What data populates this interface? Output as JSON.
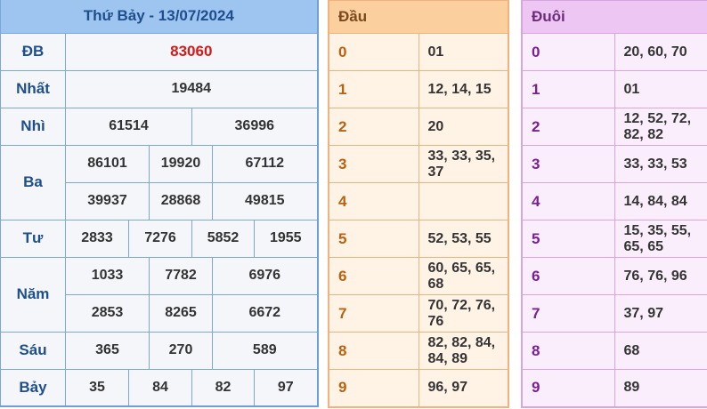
{
  "results": {
    "title": "Thứ Bảy - 13/07/2024",
    "db_label": "ĐB",
    "db_value": "83060",
    "nhat_label": "Nhất",
    "nhat_value": "19484",
    "nhi_label": "Nhì",
    "nhi_values": [
      "61514",
      "36996"
    ],
    "ba_label": "Ba",
    "ba_values": [
      "86101",
      "19920",
      "67112",
      "39937",
      "28868",
      "49815"
    ],
    "tu_label": "Tư",
    "tu_values": [
      "2833",
      "7276",
      "5852",
      "1955"
    ],
    "nam_label": "Năm",
    "nam_values": [
      "1033",
      "7782",
      "6976",
      "2853",
      "8265",
      "6672"
    ],
    "sau_label": "Sáu",
    "sau_values": [
      "365",
      "270",
      "589"
    ],
    "bay_label": "Bảy",
    "bay_values": [
      "35",
      "84",
      "82",
      "97"
    ]
  },
  "dau": {
    "header": "Đầu",
    "rows": [
      {
        "digit": "0",
        "values": "01"
      },
      {
        "digit": "1",
        "values": "12, 14, 15"
      },
      {
        "digit": "2",
        "values": "20"
      },
      {
        "digit": "3",
        "values": "33, 33, 35, 37"
      },
      {
        "digit": "4",
        "values": ""
      },
      {
        "digit": "5",
        "values": "52, 53, 55"
      },
      {
        "digit": "6",
        "values": "60, 65, 65, 68"
      },
      {
        "digit": "7",
        "values": "70, 72, 76, 76"
      },
      {
        "digit": "8",
        "values": "82, 82, 84, 84, 89"
      },
      {
        "digit": "9",
        "values": "96, 97"
      }
    ]
  },
  "duoi": {
    "header": "Đuôi",
    "rows": [
      {
        "digit": "0",
        "values": "20, 60, 70"
      },
      {
        "digit": "1",
        "values": "01"
      },
      {
        "digit": "2",
        "values": "12, 52, 72, 82, 82"
      },
      {
        "digit": "3",
        "values": "33, 33, 53"
      },
      {
        "digit": "4",
        "values": "14, 84, 84"
      },
      {
        "digit": "5",
        "values": "15, 35, 55, 65, 65"
      },
      {
        "digit": "6",
        "values": "76, 76, 96"
      },
      {
        "digit": "7",
        "values": "37, 97"
      },
      {
        "digit": "8",
        "values": "68"
      },
      {
        "digit": "9",
        "values": "89"
      }
    ]
  },
  "colors": {
    "special_prize": "#d51a1a",
    "results_header": "#9ec4f0",
    "dau_header": "#fccf9e",
    "duoi_header": "#eec6f3"
  }
}
